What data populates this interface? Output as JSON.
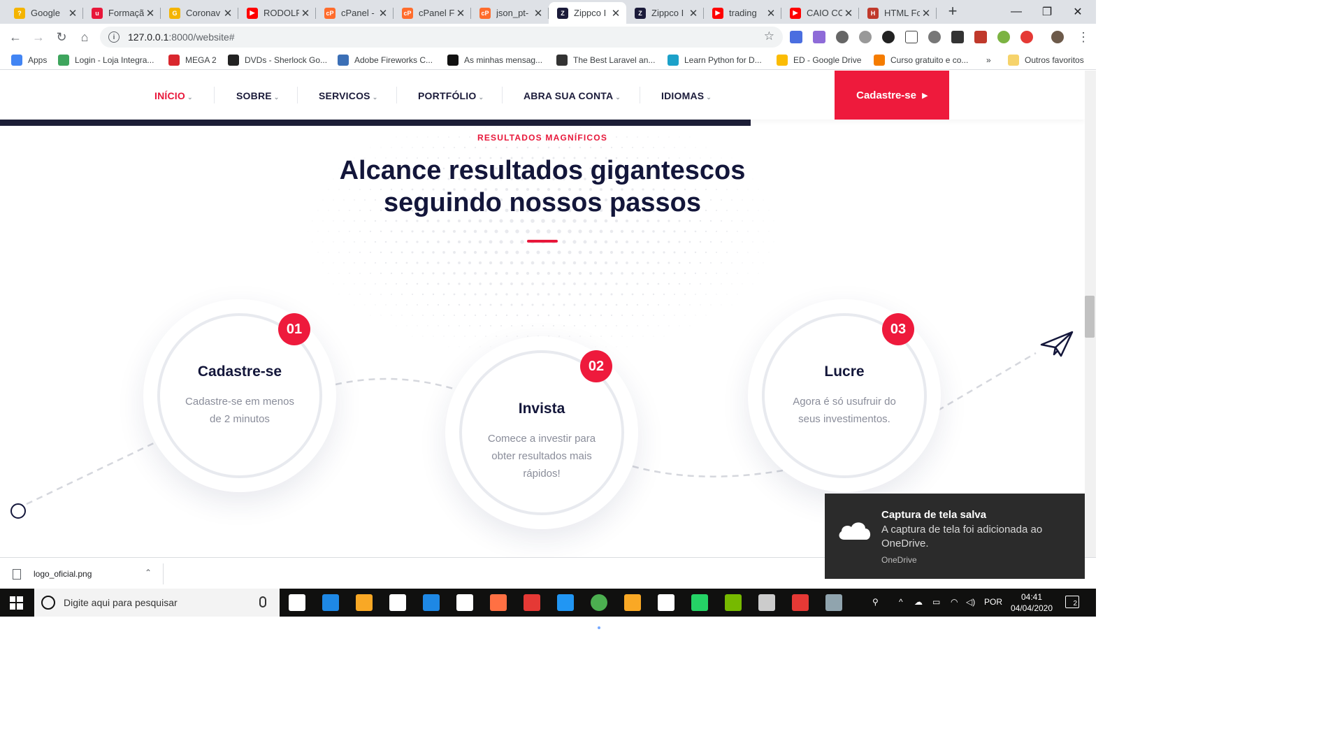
{
  "browser": {
    "tabs": [
      {
        "title": "Google",
        "color": "#f4b400",
        "glyph": "?"
      },
      {
        "title": "Formaçã",
        "color": "#e8173a",
        "glyph": "u"
      },
      {
        "title": "Coronav",
        "color": "#f4b400",
        "glyph": "G"
      },
      {
        "title": "RODOLF",
        "color": "#ff0000",
        "glyph": "▶"
      },
      {
        "title": "cPanel -",
        "color": "#ff6c2c",
        "glyph": "cP"
      },
      {
        "title": "cPanel F",
        "color": "#ff6c2c",
        "glyph": "cP"
      },
      {
        "title": "json_pt-",
        "color": "#ff6c2c",
        "glyph": "cP"
      },
      {
        "title": "Zippco I",
        "color": "#1b1b3a",
        "glyph": "Z"
      },
      {
        "title": "Zippco I",
        "color": "#1b1b3a",
        "glyph": "Z"
      },
      {
        "title": "trading",
        "color": "#ff0000",
        "glyph": "▶"
      },
      {
        "title": "CAIO CC",
        "color": "#ff0000",
        "glyph": "▶"
      },
      {
        "title": "HTML Fc",
        "color": "#c0392b",
        "glyph": "H"
      }
    ],
    "active_tab_index": 7,
    "url_host": "127.0.0.1",
    "url_path": ":8000/website#",
    "bookmarks": [
      {
        "label": "Apps",
        "color": "#4285f4"
      },
      {
        "label": "Login - Loja Integra...",
        "color": "#3ea55d"
      },
      {
        "label": "MEGA 2",
        "color": "#d9272e"
      },
      {
        "label": "DVDs - Sherlock Go...",
        "color": "#222222"
      },
      {
        "label": "Adobe Fireworks C...",
        "color": "#3b6fb6"
      },
      {
        "label": "As minhas mensag...",
        "color": "#111111"
      },
      {
        "label": "The Best Laravel an...",
        "color": "#333333"
      },
      {
        "label": "Learn Python for D...",
        "color": "#1ca1c9"
      },
      {
        "label": "ED - Google Drive",
        "color": "#fbbc04"
      },
      {
        "label": "Curso gratuito e co...",
        "color": "#f57c00"
      }
    ],
    "bookmarks_more": "»",
    "other_bookmarks": "Outros favoritos"
  },
  "site": {
    "nav": [
      {
        "label": "INÍCIO",
        "active": true
      },
      {
        "label": "SOBRE",
        "active": false
      },
      {
        "label": "SERVICOS",
        "active": false
      },
      {
        "label": "PORTFÓLIO",
        "active": false
      },
      {
        "label": "ABRA SUA CONTA",
        "active": false
      },
      {
        "label": "IDIOMAS",
        "active": false
      }
    ],
    "cta_label": "Cadastre-se",
    "cta_arrow": "▸",
    "eyebrow": "RESULTADOS MAGNÍFICOS",
    "headline_line1": "Alcance resultados gigantescos",
    "headline_line2": "seguindo nossos passos",
    "steps": [
      {
        "number": "01",
        "title": "Cadastre-se",
        "desc": "Cadastre-se em menos de 2 minutos"
      },
      {
        "number": "02",
        "title": "Invista",
        "desc": "Comece a investir para obter resultados mais rápidos!"
      },
      {
        "number": "03",
        "title": "Lucre",
        "desc": "Agora é só usufruir do seus investimentos."
      }
    ],
    "accent": "#ee1a3c",
    "dark": "#13163a"
  },
  "download": {
    "filename": "logo_oficial.png"
  },
  "toast": {
    "title": "Captura de tela salva",
    "body": "A captura de tela foi adicionada ao OneDrive.",
    "source": "OneDrive"
  },
  "taskbar": {
    "search_placeholder": "Digite aqui para pesquisar",
    "language": "POR",
    "time": "04:41",
    "date": "04/04/2020",
    "notifications": "2"
  }
}
